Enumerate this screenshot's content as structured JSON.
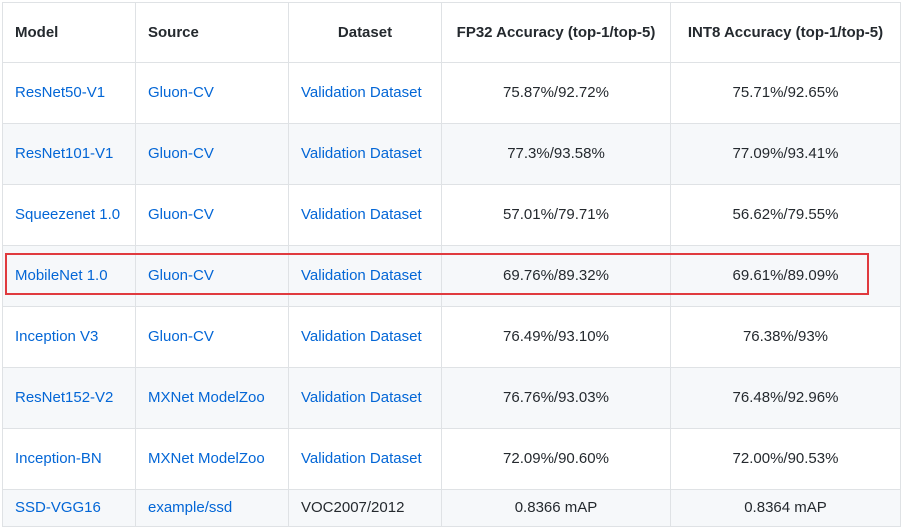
{
  "table": {
    "headers": [
      "Model",
      "Source",
      "Dataset",
      "FP32 Accuracy (top-1/top-5)",
      "INT8 Accuracy (top-1/top-5)"
    ],
    "rows": [
      {
        "model": "ResNet50-V1",
        "source": "Gluon-CV",
        "dataset": "Validation Dataset",
        "fp32": "75.87%/92.72%",
        "int8": "75.71%/92.65%"
      },
      {
        "model": "ResNet101-V1",
        "source": "Gluon-CV",
        "dataset": "Validation Dataset",
        "fp32": "77.3%/93.58%",
        "int8": "77.09%/93.41%"
      },
      {
        "model": "Squeezenet 1.0",
        "source": "Gluon-CV",
        "dataset": "Validation Dataset",
        "fp32": "57.01%/79.71%",
        "int8": "56.62%/79.55%"
      },
      {
        "model": "MobileNet 1.0",
        "source": "Gluon-CV",
        "dataset": "Validation Dataset",
        "fp32": "69.76%/89.32%",
        "int8": "69.61%/89.09%"
      },
      {
        "model": "Inception V3",
        "source": "Gluon-CV",
        "dataset": "Validation Dataset",
        "fp32": "76.49%/93.10%",
        "int8": "76.38%/93%"
      },
      {
        "model": "ResNet152-V2",
        "source": "MXNet ModelZoo",
        "dataset": "Validation Dataset",
        "fp32": "76.76%/93.03%",
        "int8": "76.48%/92.96%"
      },
      {
        "model": "Inception-BN",
        "source": "MXNet ModelZoo",
        "dataset": "Validation Dataset",
        "fp32": "72.09%/90.60%",
        "int8": "72.00%/90.53%"
      },
      {
        "model": "SSD-VGG16",
        "source": "example/ssd",
        "dataset": "VOC2007/2012",
        "fp32": "0.8366 mAP",
        "int8": "0.8364 mAP"
      }
    ]
  },
  "colors": {
    "link": "#0366d6",
    "highlight_border": "#e03a3e",
    "stripe": "#f6f8fa",
    "border": "#dfe2e5"
  }
}
